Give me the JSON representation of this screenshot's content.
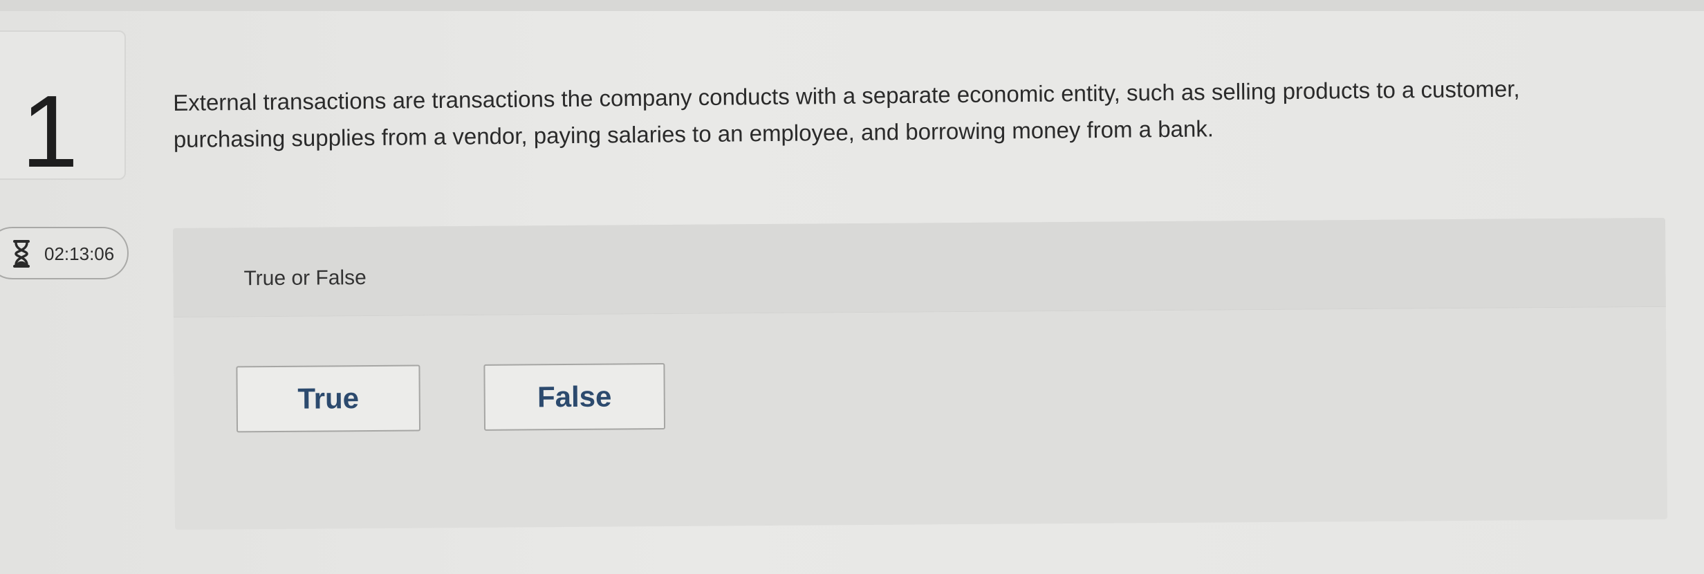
{
  "question": {
    "number": "1",
    "text": "External transactions are transactions the company conducts with a separate economic entity, such as selling products to a customer, purchasing supplies from a vendor, paying salaries to an employee, and borrowing money from a bank."
  },
  "timer": {
    "icon": "hourglass-icon",
    "value": "02:13:06"
  },
  "answer": {
    "type_label": "True or False",
    "choices": [
      {
        "label": "True"
      },
      {
        "label": "False"
      }
    ]
  },
  "colors": {
    "choice_text": "#2c4a6e",
    "panel_background": "#dededc",
    "page_background": "#e7e7e5"
  }
}
